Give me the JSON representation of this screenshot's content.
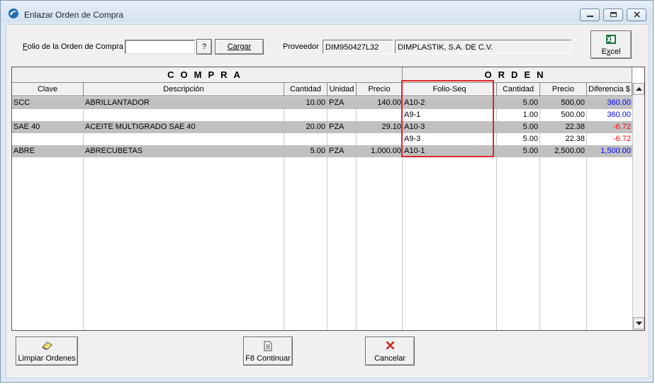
{
  "window": {
    "title": "Enlazar Orden de Compra"
  },
  "form": {
    "folio_label": "Folio de la Orden de Compra",
    "folio_value": "",
    "help_button": "?",
    "load_button": "Cargar",
    "proveedor_label": "Proveedor",
    "proveedor_rfc": "DIM950427L32",
    "proveedor_name": "DIMPLASTIK, S.A. DE C.V.",
    "excel_button": "Excel"
  },
  "grid": {
    "group_compra": "COMPRA",
    "group_orden": "ORDEN",
    "columns": {
      "clave": "Clave",
      "descripcion": "Descripción",
      "cantidad": "Cantidad",
      "unidad": "Unidad",
      "precio": "Precio",
      "folio_seq": "Folio-Seq",
      "o_cantidad": "Cantidad",
      "o_precio": "Precio",
      "diferencia": "Diferencia $"
    },
    "rows": [
      {
        "clave": "SCC",
        "descripcion": "ABRILLANTADOR",
        "cantidad": "10.00",
        "unidad": "PZA",
        "precio": "140.00",
        "folio_seq": "A10-2",
        "o_cantidad": "5.00",
        "o_precio": "500.00",
        "diferencia": "360.00"
      },
      {
        "clave": "",
        "descripcion": "",
        "cantidad": "",
        "unidad": "",
        "precio": "",
        "folio_seq": "A9-1",
        "o_cantidad": "1.00",
        "o_precio": "500.00",
        "diferencia": "360.00"
      },
      {
        "clave": "SAE 40",
        "descripcion": "ACEITE MULTIGRADO SAE 40",
        "cantidad": "20.00",
        "unidad": "PZA",
        "precio": "29.10",
        "folio_seq": "A10-3",
        "o_cantidad": "5.00",
        "o_precio": "22.38",
        "diferencia": "-6.72"
      },
      {
        "clave": "",
        "descripcion": "",
        "cantidad": "",
        "unidad": "",
        "precio": "",
        "folio_seq": "A9-3",
        "o_cantidad": "5.00",
        "o_precio": "22.38",
        "diferencia": "-6.72"
      },
      {
        "clave": "ABRE",
        "descripcion": "ABRECUBETAS",
        "cantidad": "5.00",
        "unidad": "PZA",
        "precio": "1,000.00",
        "folio_seq": "A10-1",
        "o_cantidad": "5.00",
        "o_precio": "2,500.00",
        "diferencia": "1,500.00"
      }
    ]
  },
  "footer": {
    "clear_button": "Limpiar Ordenes",
    "continue_button": "F8 Continuar",
    "cancel_button": "Cancelar"
  },
  "colors": {
    "positive_difference": "#0000ff",
    "negative_difference": "#ff0000",
    "highlight_box": "#e0242c",
    "group_row": "#c0c0c0"
  }
}
